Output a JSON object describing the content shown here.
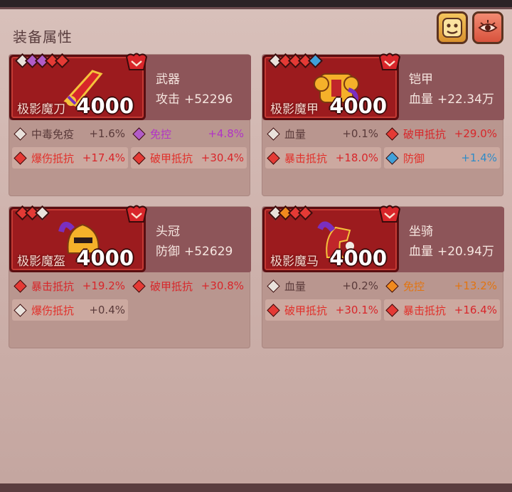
{
  "section_title": "装备属性",
  "cards": [
    {
      "id": "weapon",
      "slot": "武器",
      "item_name": "极影魔刀",
      "score": "4000",
      "main_stat_label": "攻击",
      "main_stat_value": "+52296",
      "gems": [
        "white",
        "purple",
        "purple",
        "red",
        "red"
      ],
      "rows": [
        [
          {
            "label": "中毒免疫",
            "value": "+1.6%",
            "gem": "white",
            "color": "#5a3a3a"
          },
          {
            "label": "免控",
            "value": "+4.8%",
            "gem": "purple",
            "color": "#b233c6"
          }
        ],
        [
          {
            "label": "爆伤抵抗",
            "value": "+17.4%",
            "gem": "red",
            "color": "#d8262a"
          },
          {
            "label": "破甲抵抗",
            "value": "+30.4%",
            "gem": "red",
            "color": "#d8262a"
          }
        ]
      ]
    },
    {
      "id": "armor",
      "slot": "铠甲",
      "item_name": "极影魔甲",
      "score": "4000",
      "main_stat_label": "血量",
      "main_stat_value": "+22.34万",
      "gems": [
        "white",
        "red",
        "red",
        "red",
        "blue"
      ],
      "rows": [
        [
          {
            "label": "血量",
            "value": "+0.1%",
            "gem": "white",
            "color": "#5a3a3a"
          },
          {
            "label": "破甲抵抗",
            "value": "+29.0%",
            "gem": "red",
            "color": "#d8262a"
          }
        ],
        [
          {
            "label": "暴击抵抗",
            "value": "+18.0%",
            "gem": "red",
            "color": "#d8262a"
          },
          {
            "label": "防御",
            "value": "+1.4%",
            "gem": "blue",
            "color": "#2f8bc7"
          }
        ]
      ]
    },
    {
      "id": "helmet",
      "slot": "头冠",
      "item_name": "极影魔盔",
      "score": "4000",
      "main_stat_label": "防御",
      "main_stat_value": "+52629",
      "gems": [
        "red",
        "red",
        "white"
      ],
      "rows": [
        [
          {
            "label": "暴击抵抗",
            "value": "+19.2%",
            "gem": "red",
            "color": "#d8262a"
          },
          {
            "label": "破甲抵抗",
            "value": "+30.8%",
            "gem": "red",
            "color": "#d8262a"
          }
        ],
        [
          {
            "label": "爆伤抵抗",
            "value": "+0.4%",
            "gem": "white",
            "color": "#5a3a3a"
          }
        ]
      ]
    },
    {
      "id": "mount",
      "slot": "坐骑",
      "item_name": "极影魔马",
      "score": "4000",
      "main_stat_label": "血量",
      "main_stat_value": "+20.94万",
      "gems": [
        "white",
        "orange",
        "red",
        "red"
      ],
      "rows": [
        [
          {
            "label": "血量",
            "value": "+0.2%",
            "gem": "white",
            "color": "#5a3a3a"
          },
          {
            "label": "免控",
            "value": "+13.2%",
            "gem": "orange",
            "color": "#e27410"
          }
        ],
        [
          {
            "label": "破甲抵抗",
            "value": "+30.1%",
            "gem": "red",
            "color": "#d8262a"
          },
          {
            "label": "暴击抵抗",
            "value": "+16.4%",
            "gem": "red",
            "color": "#d8262a"
          }
        ]
      ]
    }
  ],
  "buttons": {
    "face": "face-icon",
    "eye": "eye-icon"
  }
}
